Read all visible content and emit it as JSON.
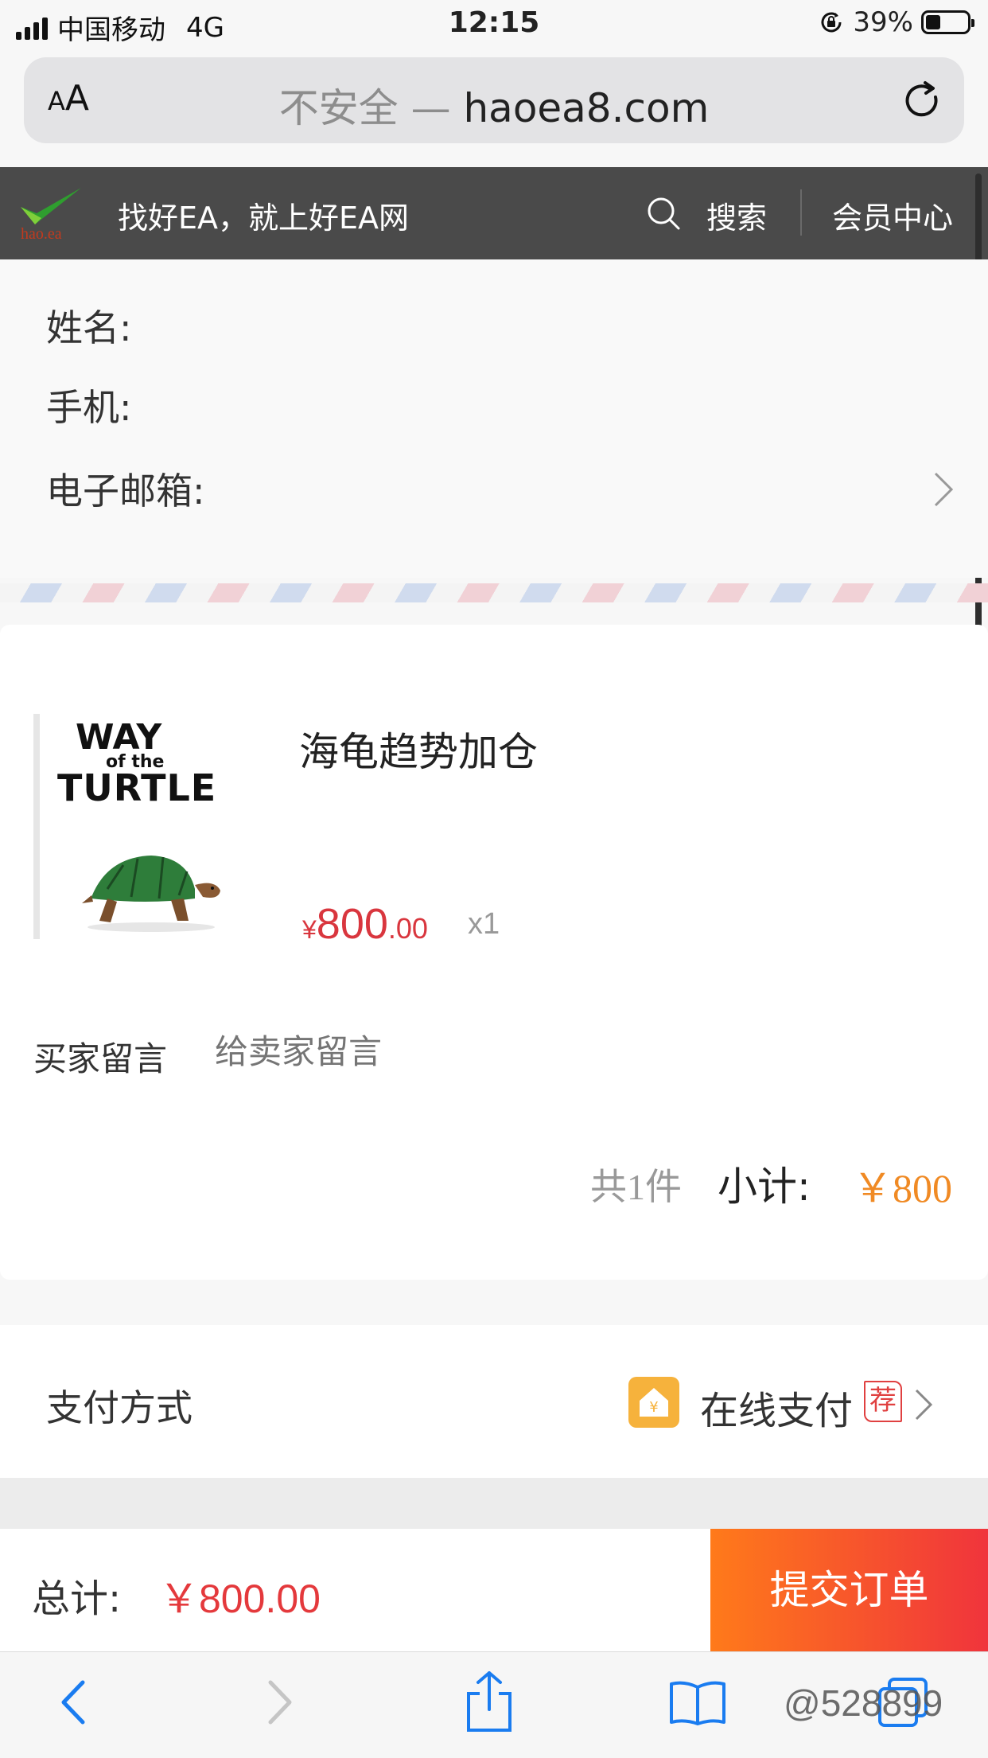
{
  "status_bar": {
    "carrier": "中国移动",
    "network": "4G",
    "time": "12:15",
    "battery": "39%"
  },
  "browser": {
    "text_size_button": "AA",
    "url_prefix": "不安全 — ",
    "domain": "haoea8.com"
  },
  "site_header": {
    "logo_text": "hao.ea",
    "slogan": "找好EA，就上好EA网",
    "search": "搜索",
    "member_center": "会员中心"
  },
  "contact": {
    "name_label": "姓名:",
    "phone_label": "手机:",
    "email_label": "电子邮箱:"
  },
  "product": {
    "cover_line1": "WAY",
    "cover_line2": "of the",
    "cover_line3": "TURTLE",
    "name": "海龟趋势加仓",
    "currency": "¥",
    "price_int": "800",
    "price_dec": ".00",
    "quantity": "x1"
  },
  "message": {
    "label": "买家留言",
    "placeholder": "给卖家留言"
  },
  "summary": {
    "count": "共1件",
    "subtotal_label": "小计:",
    "subtotal_value": "￥800"
  },
  "payment": {
    "label": "支付方式",
    "icon_glyph": "¥",
    "method": "在线支付",
    "recommend_badge": "荐"
  },
  "footer": {
    "total_label": "总计:",
    "total_value": "￥800.00",
    "submit": "提交订单"
  },
  "watermark": "@528899",
  "colors": {
    "price_red": "#d9363e",
    "subtotal_orange": "#f08a24",
    "submit_start": "#ff7a1a",
    "submit_end": "#f0343c",
    "header_bg": "#4a4a4a"
  },
  "icons": [
    "signal-icon",
    "orientation-lock-icon",
    "battery-icon",
    "reload-icon",
    "site-logo-icon",
    "search-icon",
    "chevron-right-icon",
    "turtle-icon",
    "home-pay-icon",
    "back-icon",
    "forward-icon",
    "share-icon",
    "bookmarks-icon",
    "tabs-icon"
  ]
}
